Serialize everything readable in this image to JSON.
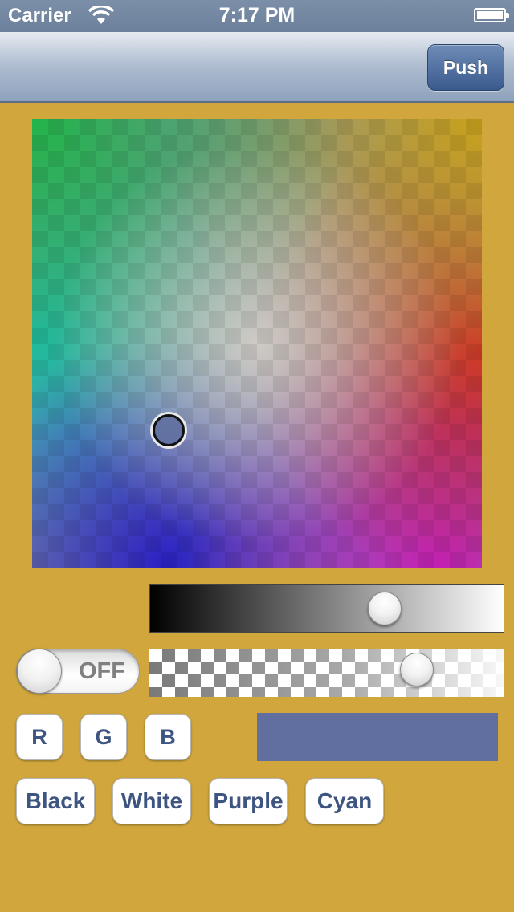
{
  "status_bar": {
    "carrier": "Carrier",
    "time": "7:17 PM",
    "wifi_icon": "wifi-icon",
    "battery_icon": "battery-icon"
  },
  "nav_bar": {
    "push_label": "Push"
  },
  "color_picker": {
    "selected_color": "#606f9f"
  },
  "brightness_slider": {
    "value": 0.68
  },
  "alpha_toggle": {
    "label": "OFF",
    "state": false
  },
  "alpha_slider": {
    "value": 0.78
  },
  "channel_buttons": [
    "R",
    "G",
    "B"
  ],
  "preset_buttons": [
    "Black",
    "White",
    "Purple",
    "Cyan"
  ],
  "colors": {
    "background": "#d0a63d",
    "button_text": "#3d5580",
    "nav_button": "#3a5a8e",
    "swatch": "#606f9f"
  }
}
